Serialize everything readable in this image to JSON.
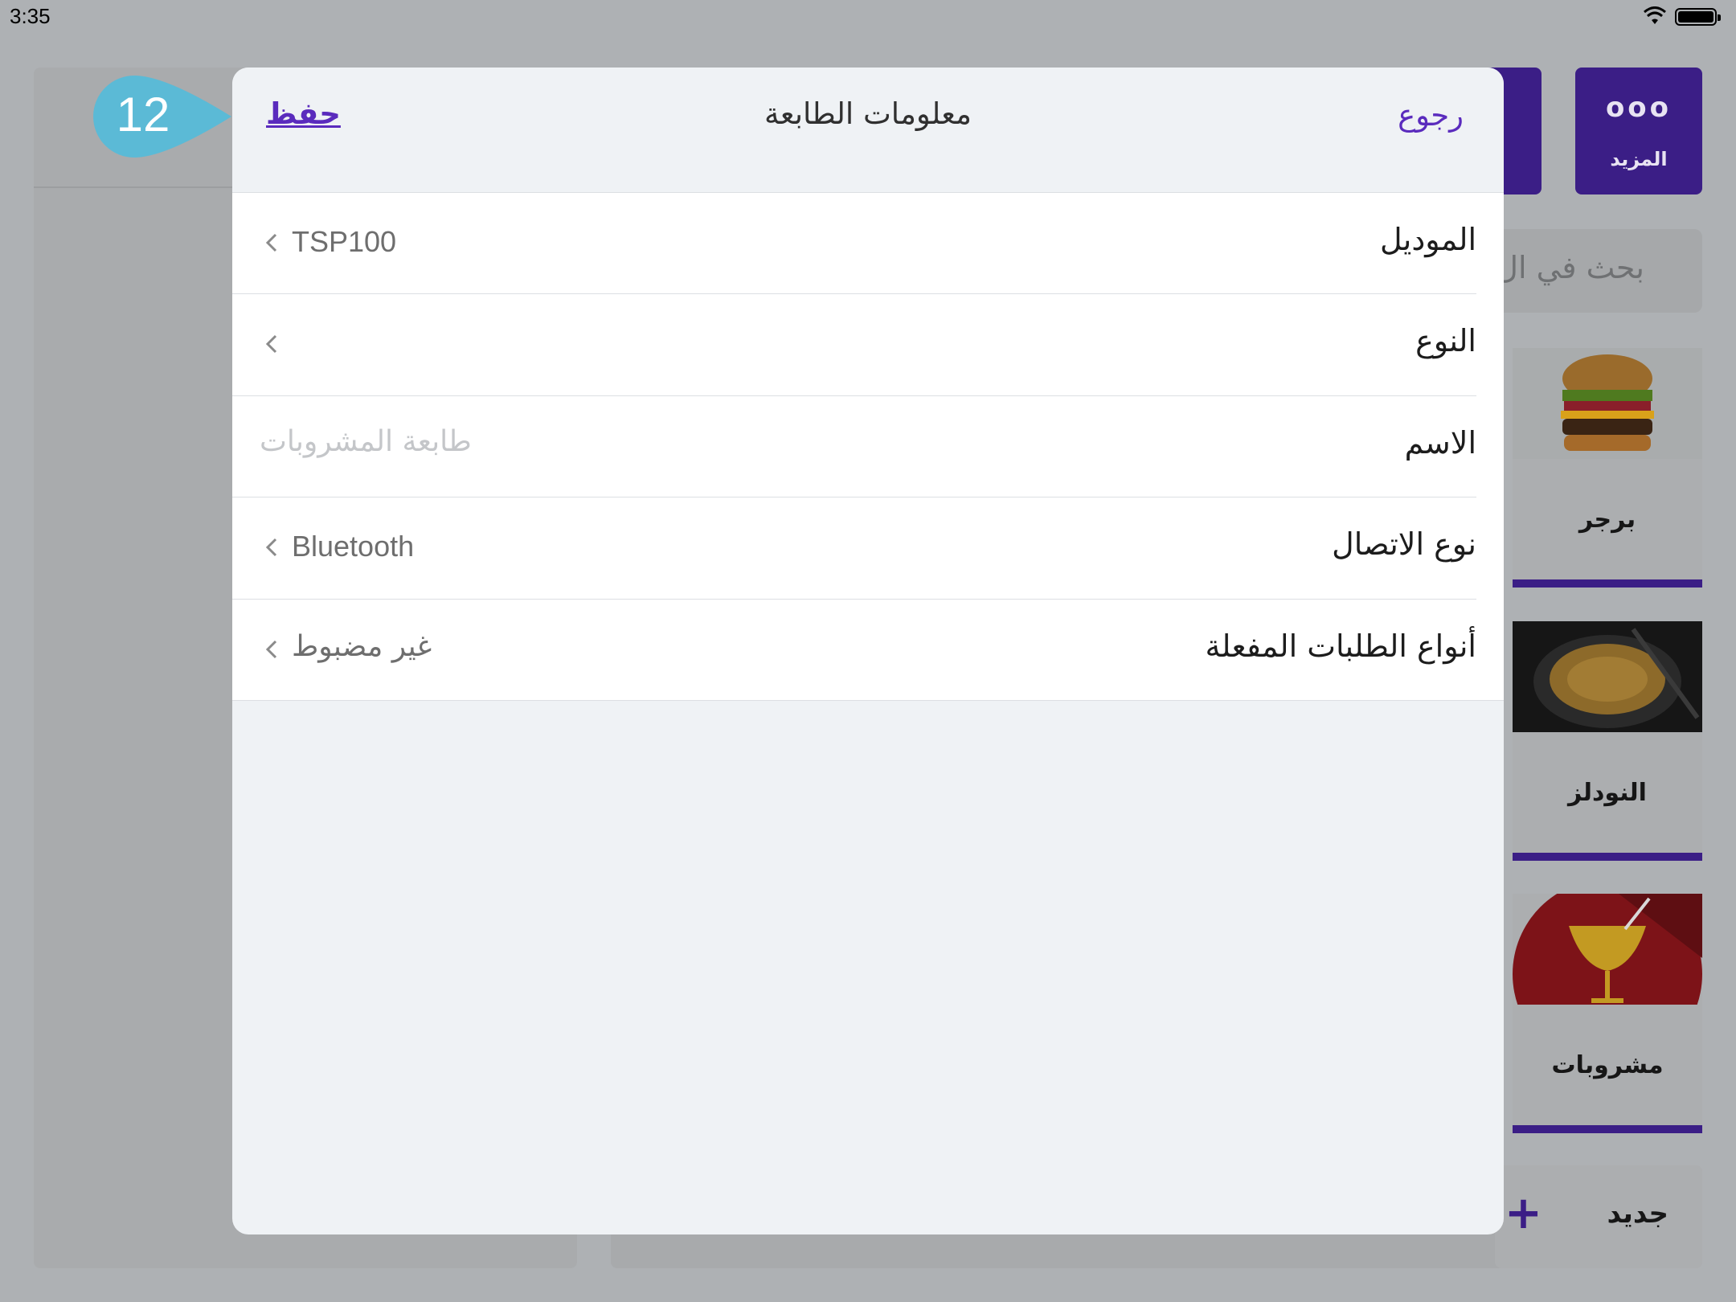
{
  "status_bar": {
    "time": "3:35"
  },
  "background": {
    "more_button": {
      "icon": "more-dots-icon",
      "dots": "ooo",
      "label": "المزيد"
    },
    "search_placeholder": "بحث في ال",
    "categories": [
      {
        "name": "برجر",
        "image": "burger"
      },
      {
        "name": "النودلز",
        "image": "noodles"
      },
      {
        "name": "مشروبات",
        "image": "drink-glass"
      }
    ],
    "new_button": {
      "label": "جديد",
      "icon": "plus-icon"
    }
  },
  "modal": {
    "title": "معلومات الطابعة",
    "save_label": "حفظ",
    "back_label": "رجوع",
    "rows": [
      {
        "label": "الموديل",
        "value": "TSP100"
      },
      {
        "label": "النوع",
        "value": ""
      },
      {
        "label": "الاسم",
        "placeholder": "طابعة المشروبات"
      },
      {
        "label": "نوع الاتصال",
        "value": "Bluetooth"
      },
      {
        "label": "أنواع الطلبات المفعلة",
        "value": "غير مضبوط"
      }
    ]
  },
  "step_marker": {
    "number": "12"
  },
  "colors": {
    "accent": "#5a2bbd",
    "brand_dark": "#3b1e86",
    "modal_bg": "#eff2f5",
    "step_marker": "#5bbad6"
  }
}
